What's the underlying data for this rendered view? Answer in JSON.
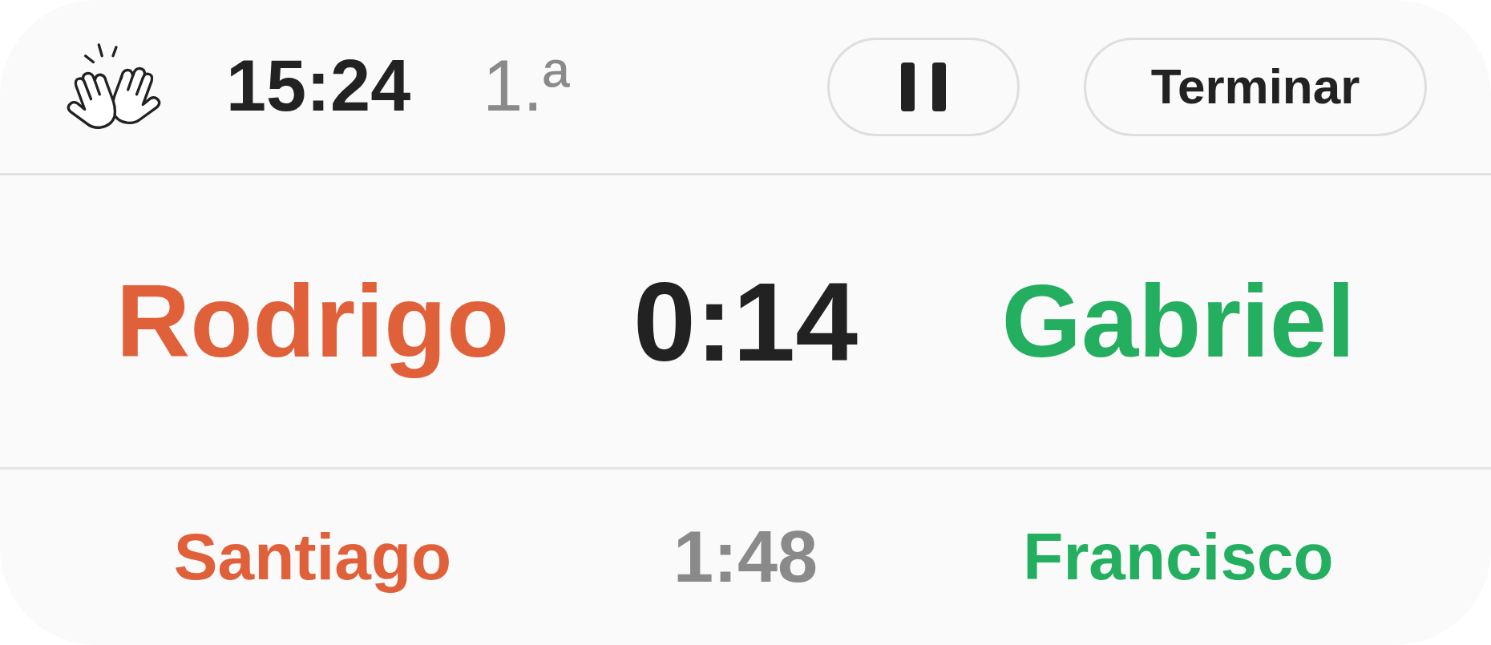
{
  "header": {
    "clock": "15:24",
    "period": "1.ª",
    "end_button": {
      "label": "Terminar"
    }
  },
  "bouts": [
    {
      "kind": "current",
      "time": "0:14",
      "players": [
        {
          "name": "Rodrigo",
          "color": "#e0603a"
        },
        {
          "name": "Gabriel",
          "color": "#24ae5f"
        }
      ]
    },
    {
      "kind": "upcoming",
      "time": "1:48",
      "players": [
        {
          "name": "Santiago",
          "color": "#e0603a"
        },
        {
          "name": "Francisco",
          "color": "#24ae5f"
        }
      ]
    }
  ]
}
